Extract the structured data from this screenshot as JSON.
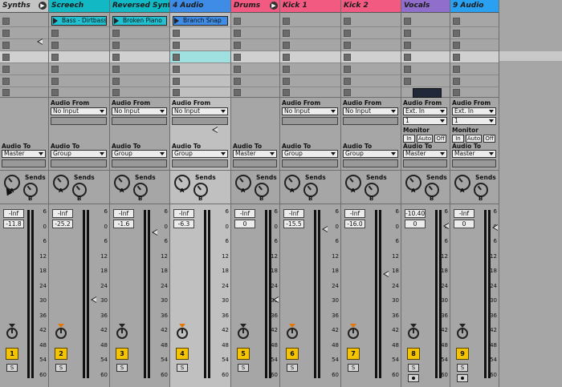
{
  "tracks": [
    {
      "name": "Synths",
      "color": "#c4c4c4",
      "fold": true,
      "clip": null,
      "audio_from": null,
      "audio_to": "Master",
      "sends_label": "Sends",
      "vol": "-Inf",
      "vol2": "-11.8",
      "number": "1",
      "solo": "S",
      "arm": false,
      "pan_orange": false,
      "highlight": false
    },
    {
      "name": "Screech",
      "color": "#12b9c4",
      "fold": false,
      "clip": {
        "label": "Bass - Dirtbass",
        "color": "#21c1d1"
      },
      "audio_from": {
        "label": "Audio From",
        "value": "No Input"
      },
      "audio_to": "Group",
      "sends_label": "Sends",
      "vol": "-Inf",
      "vol2": "-25.2",
      "number": "2",
      "solo": "S",
      "arm": false,
      "pan_orange": true,
      "highlight": false
    },
    {
      "name": "Reversed Synth",
      "color": "#12b9c4",
      "fold": false,
      "clip": {
        "label": "Broken Piano",
        "color": "#21c1d1"
      },
      "audio_from": {
        "label": "Audio From",
        "value": "No Input"
      },
      "audio_to": "Group",
      "sends_label": "Sends",
      "vol": "-Inf",
      "vol2": "-1.6",
      "number": "3",
      "solo": "S",
      "arm": false,
      "pan_orange": false,
      "highlight": false
    },
    {
      "name": "4 Audio",
      "color": "#3f8ce6",
      "fold": false,
      "clip": {
        "label": "Branch Snap",
        "color": "#3f8ce6"
      },
      "audio_from": {
        "label": "Audio From",
        "value": "No Input"
      },
      "audio_to": "Group",
      "sends_label": "Sends",
      "vol": "-Inf",
      "vol2": "-6.3",
      "number": "4",
      "solo": "S",
      "arm": false,
      "pan_orange": true,
      "highlight": true
    },
    {
      "name": "Drums",
      "color": "#f25a82",
      "fold": true,
      "clip": null,
      "audio_from": null,
      "audio_to": "Master",
      "sends_label": "Sends",
      "vol": "-Inf",
      "vol2": "0",
      "number": "5",
      "solo": "S",
      "arm": false,
      "pan_orange": false,
      "highlight": false
    },
    {
      "name": "Kick 1",
      "color": "#f25a82",
      "fold": false,
      "clip": null,
      "audio_from": {
        "label": "Audio From",
        "value": "No Input"
      },
      "audio_to": "Group",
      "sends_label": "Sends",
      "vol": "-Inf",
      "vol2": "-15.5",
      "number": "6",
      "solo": "S",
      "arm": false,
      "pan_orange": true,
      "highlight": false
    },
    {
      "name": "Kick 2",
      "color": "#f25a82",
      "fold": false,
      "clip": null,
      "audio_from": {
        "label": "Audio From",
        "value": "No Input"
      },
      "audio_to": "Group",
      "sends_label": "Sends",
      "vol": "-Inf",
      "vol2": "-16.0",
      "number": "7",
      "solo": "S",
      "arm": false,
      "pan_orange": true,
      "highlight": false
    },
    {
      "name": "Vocals",
      "color": "#8f6ecc",
      "fold": false,
      "clip": null,
      "audio_from": {
        "label": "Audio From",
        "value": "Ext. In",
        "channel": "1"
      },
      "monitor": {
        "label": "Monitor",
        "in": "In",
        "auto": "Auto",
        "off": "Off"
      },
      "audio_to": "Master",
      "sends_label": "Sends",
      "vol": "-10.40",
      "vol2": "0",
      "number": "8",
      "solo": "S",
      "arm": true,
      "pan_orange": false,
      "highlight": false
    },
    {
      "name": "9 Audio",
      "color": "#2aa1f0",
      "fold": false,
      "clip": null,
      "audio_from": {
        "label": "Audio From",
        "value": "Ext. In",
        "channel": "1"
      },
      "monitor": {
        "label": "Monitor",
        "in": "In",
        "auto": "Auto",
        "off": "Off"
      },
      "audio_to": "Master",
      "sends_label": "Sends",
      "vol": "-Inf",
      "vol2": "0",
      "number": "9",
      "solo": "S",
      "arm": true,
      "pan_orange": false,
      "highlight": false
    }
  ],
  "scale_labels": [
    "6",
    "0",
    "6",
    "12",
    "18",
    "24",
    "30",
    "36",
    "42",
    "48",
    "54",
    "60"
  ],
  "knob_letters": {
    "a": "A",
    "b": "B"
  },
  "audio_to_label": "Audio To"
}
